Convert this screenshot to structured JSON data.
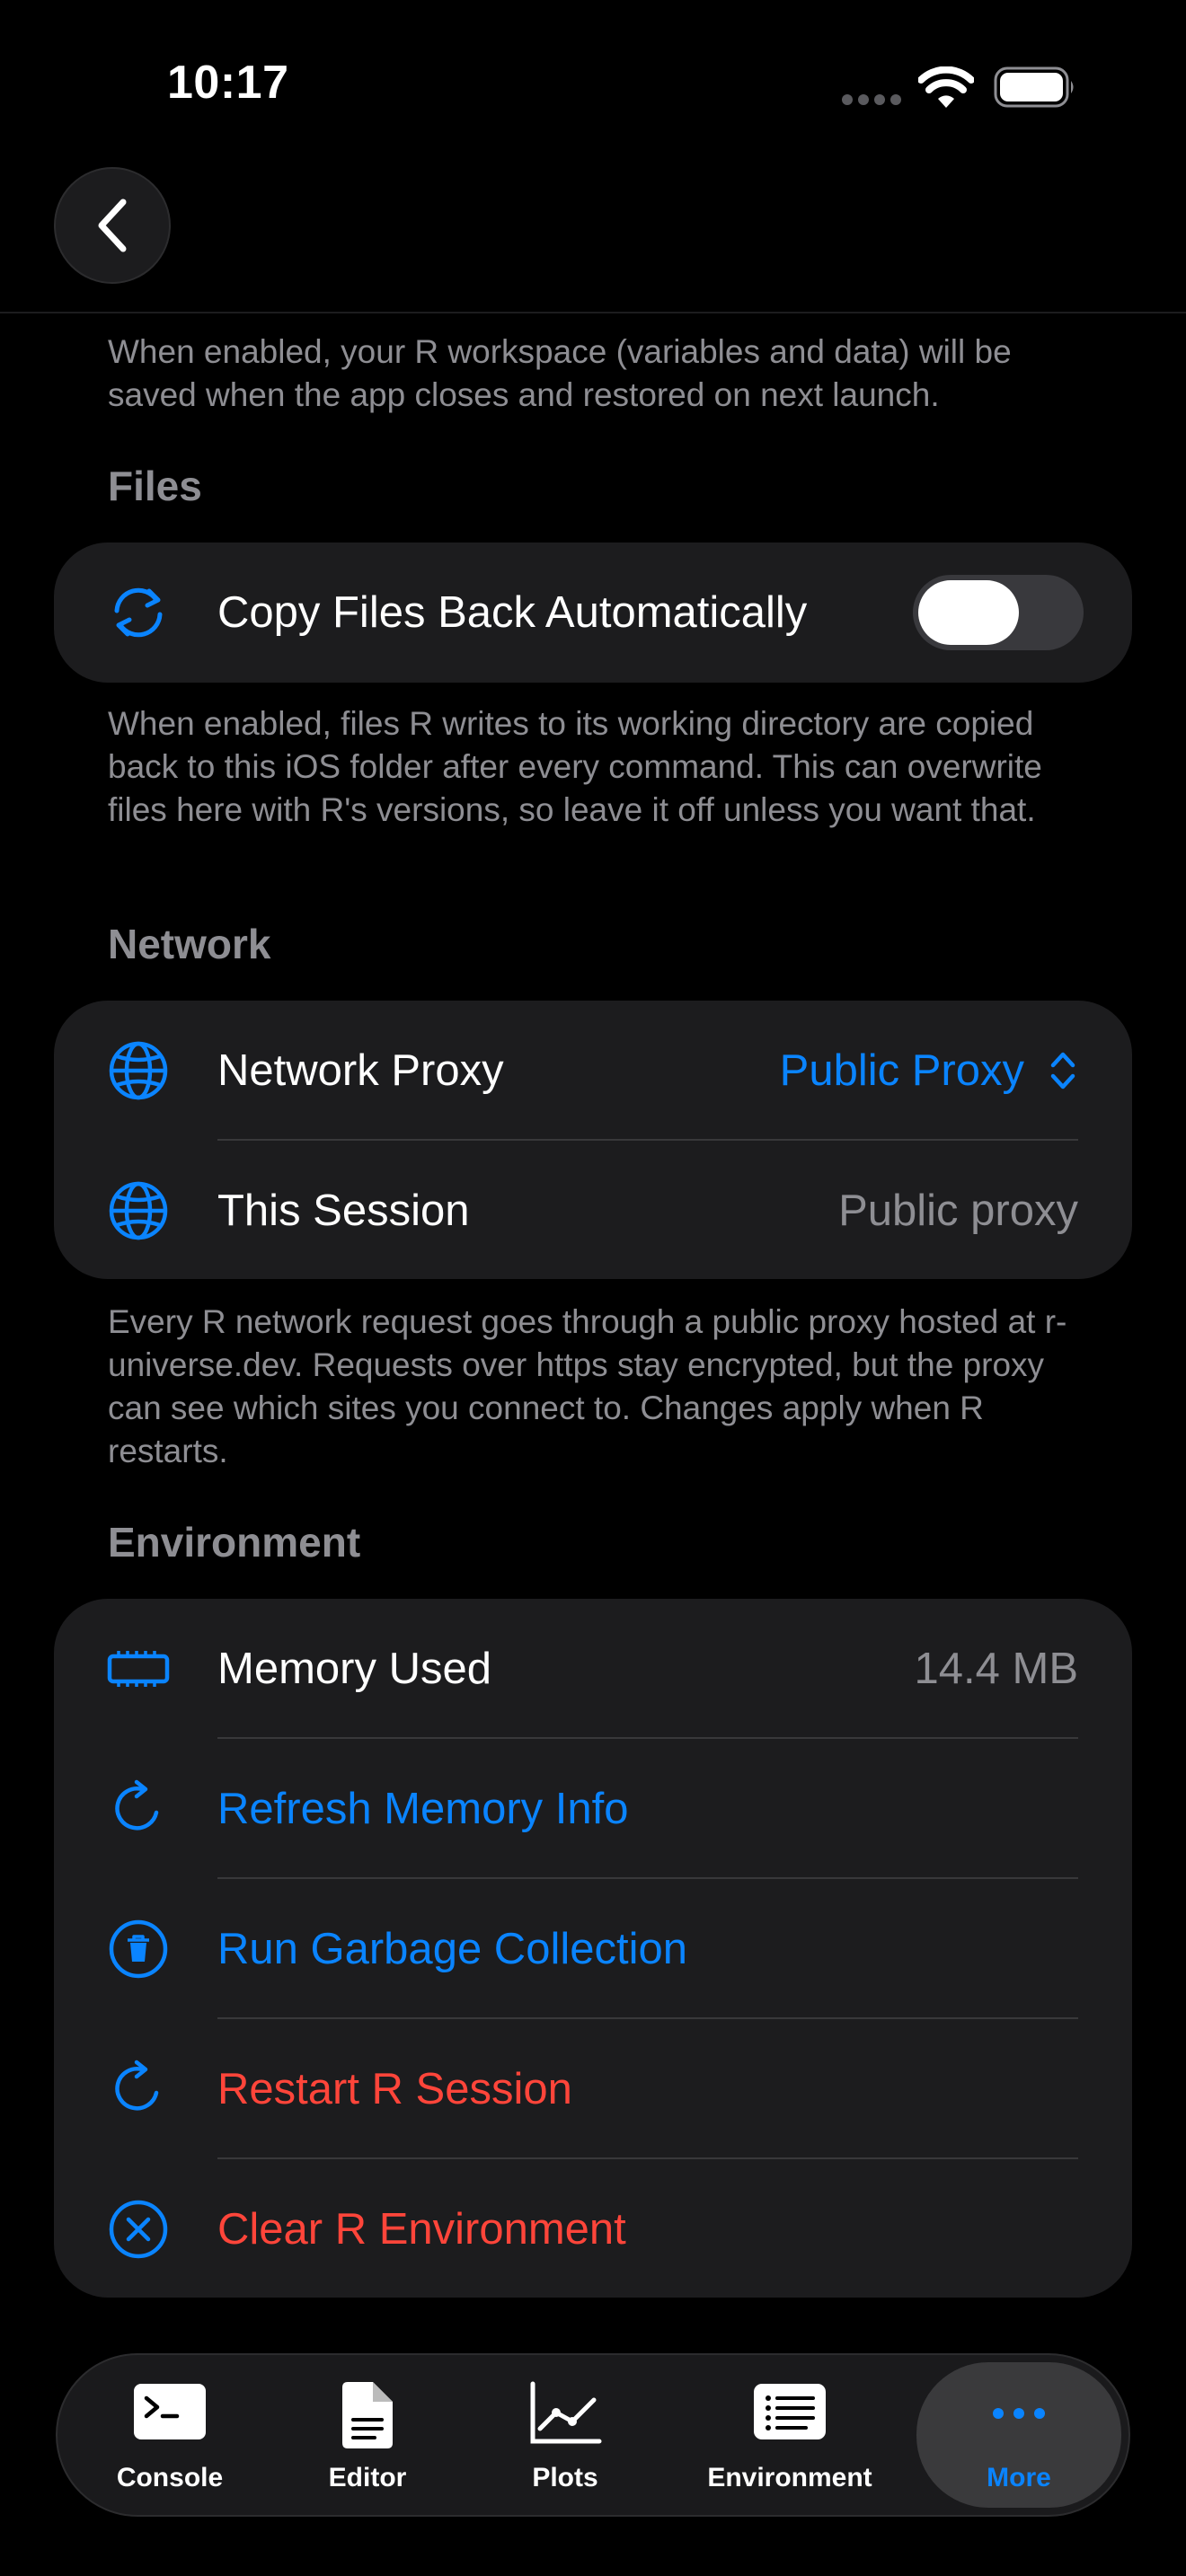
{
  "status_bar": {
    "time": "10:17"
  },
  "workspace": {
    "footnote": "When enabled, your R workspace (variables and data) will be saved when the app closes and restored on next launch."
  },
  "files": {
    "header": "Files",
    "copy_back_label": "Copy Files Back Automatically",
    "copy_back_enabled": false,
    "footnote": "When enabled, files R writes to its working directory are copied back to this iOS folder after every command. This can overwrite files here with R's versions, so leave it off unless you want that."
  },
  "network": {
    "header": "Network",
    "proxy_label": "Network Proxy",
    "proxy_value": "Public Proxy",
    "session_label": "This Session",
    "session_value": "Public proxy",
    "footnote": "Every R network request goes through a public proxy hosted at r-universe.dev. Requests over https stay encrypted, but the proxy can see which sites you connect to. Changes apply when R restarts."
  },
  "environment": {
    "header": "Environment",
    "memory_label": "Memory Used",
    "memory_value": "14.4 MB",
    "refresh_label": "Refresh Memory Info",
    "gc_label": "Run Garbage Collection",
    "restart_label": "Restart R Session",
    "clear_label": "Clear R Environment"
  },
  "tabs": [
    {
      "label": "Console",
      "icon": "terminal-icon"
    },
    {
      "label": "Editor",
      "icon": "document-icon"
    },
    {
      "label": "Plots",
      "icon": "chart-icon"
    },
    {
      "label": "Environment",
      "icon": "list-icon"
    },
    {
      "label": "More",
      "icon": "ellipsis-icon",
      "active": true
    }
  ],
  "colors": {
    "accent": "#0a84ff",
    "destructive": "#ff453a",
    "secondary_text": "#8e8e93",
    "card": "#1c1c1e"
  }
}
